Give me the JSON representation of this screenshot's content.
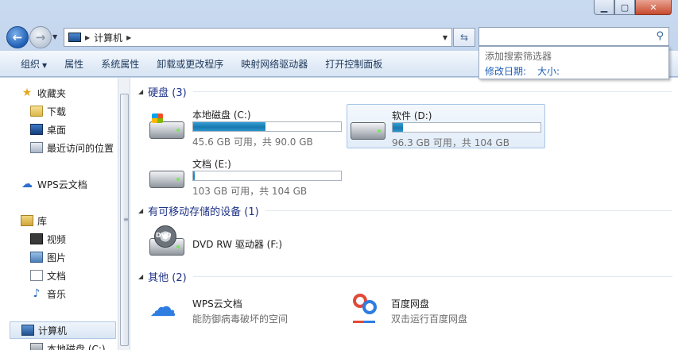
{
  "address": {
    "path": "计算机"
  },
  "toolbar": {
    "organize": "组织",
    "properties": "属性",
    "system_properties": "系统属性",
    "uninstall": "卸载或更改程序",
    "map_drive": "映射网络驱动器",
    "control_panel": "打开控制面板"
  },
  "search": {
    "placeholder": "",
    "popup_title": "添加搜索筛选器",
    "filter_date": "修改日期:",
    "filter_size": "大小:"
  },
  "sidebar": {
    "favorites": "收藏夹",
    "downloads": "下载",
    "desktop": "桌面",
    "recent": "最近访问的位置",
    "wps_cloud": "WPS云文档",
    "libraries": "库",
    "videos": "视频",
    "pictures": "图片",
    "documents": "文档",
    "music": "音乐",
    "computer": "计算机",
    "local_disk": "本地磁盘 (C:)"
  },
  "groups": {
    "hard_disks": "硬盘 (3)",
    "removable": "有可移动存储的设备 (1)",
    "other": "其他 (2)"
  },
  "drives": [
    {
      "name": "本地磁盘 (C:)",
      "info": "45.6 GB 可用，共 90.0 GB",
      "used_fraction": 0.49
    },
    {
      "name": "软件 (D:)",
      "info": "96.3 GB 可用，共 104 GB",
      "used_fraction": 0.07
    },
    {
      "name": "文档 (E:)",
      "info": "103 GB 可用，共 104 GB",
      "used_fraction": 0.01
    }
  ],
  "dvd": {
    "name": "DVD RW 驱动器 (F:)",
    "icon_label": "DVD"
  },
  "others": [
    {
      "name": "WPS云文档",
      "desc": "能防御病毒破坏的空间"
    },
    {
      "name": "百度网盘",
      "desc": "双击运行百度网盘"
    }
  ],
  "colors": {
    "accent": "#1e3287",
    "bar": "#2a8fc8",
    "link": "#1d5fb5"
  }
}
